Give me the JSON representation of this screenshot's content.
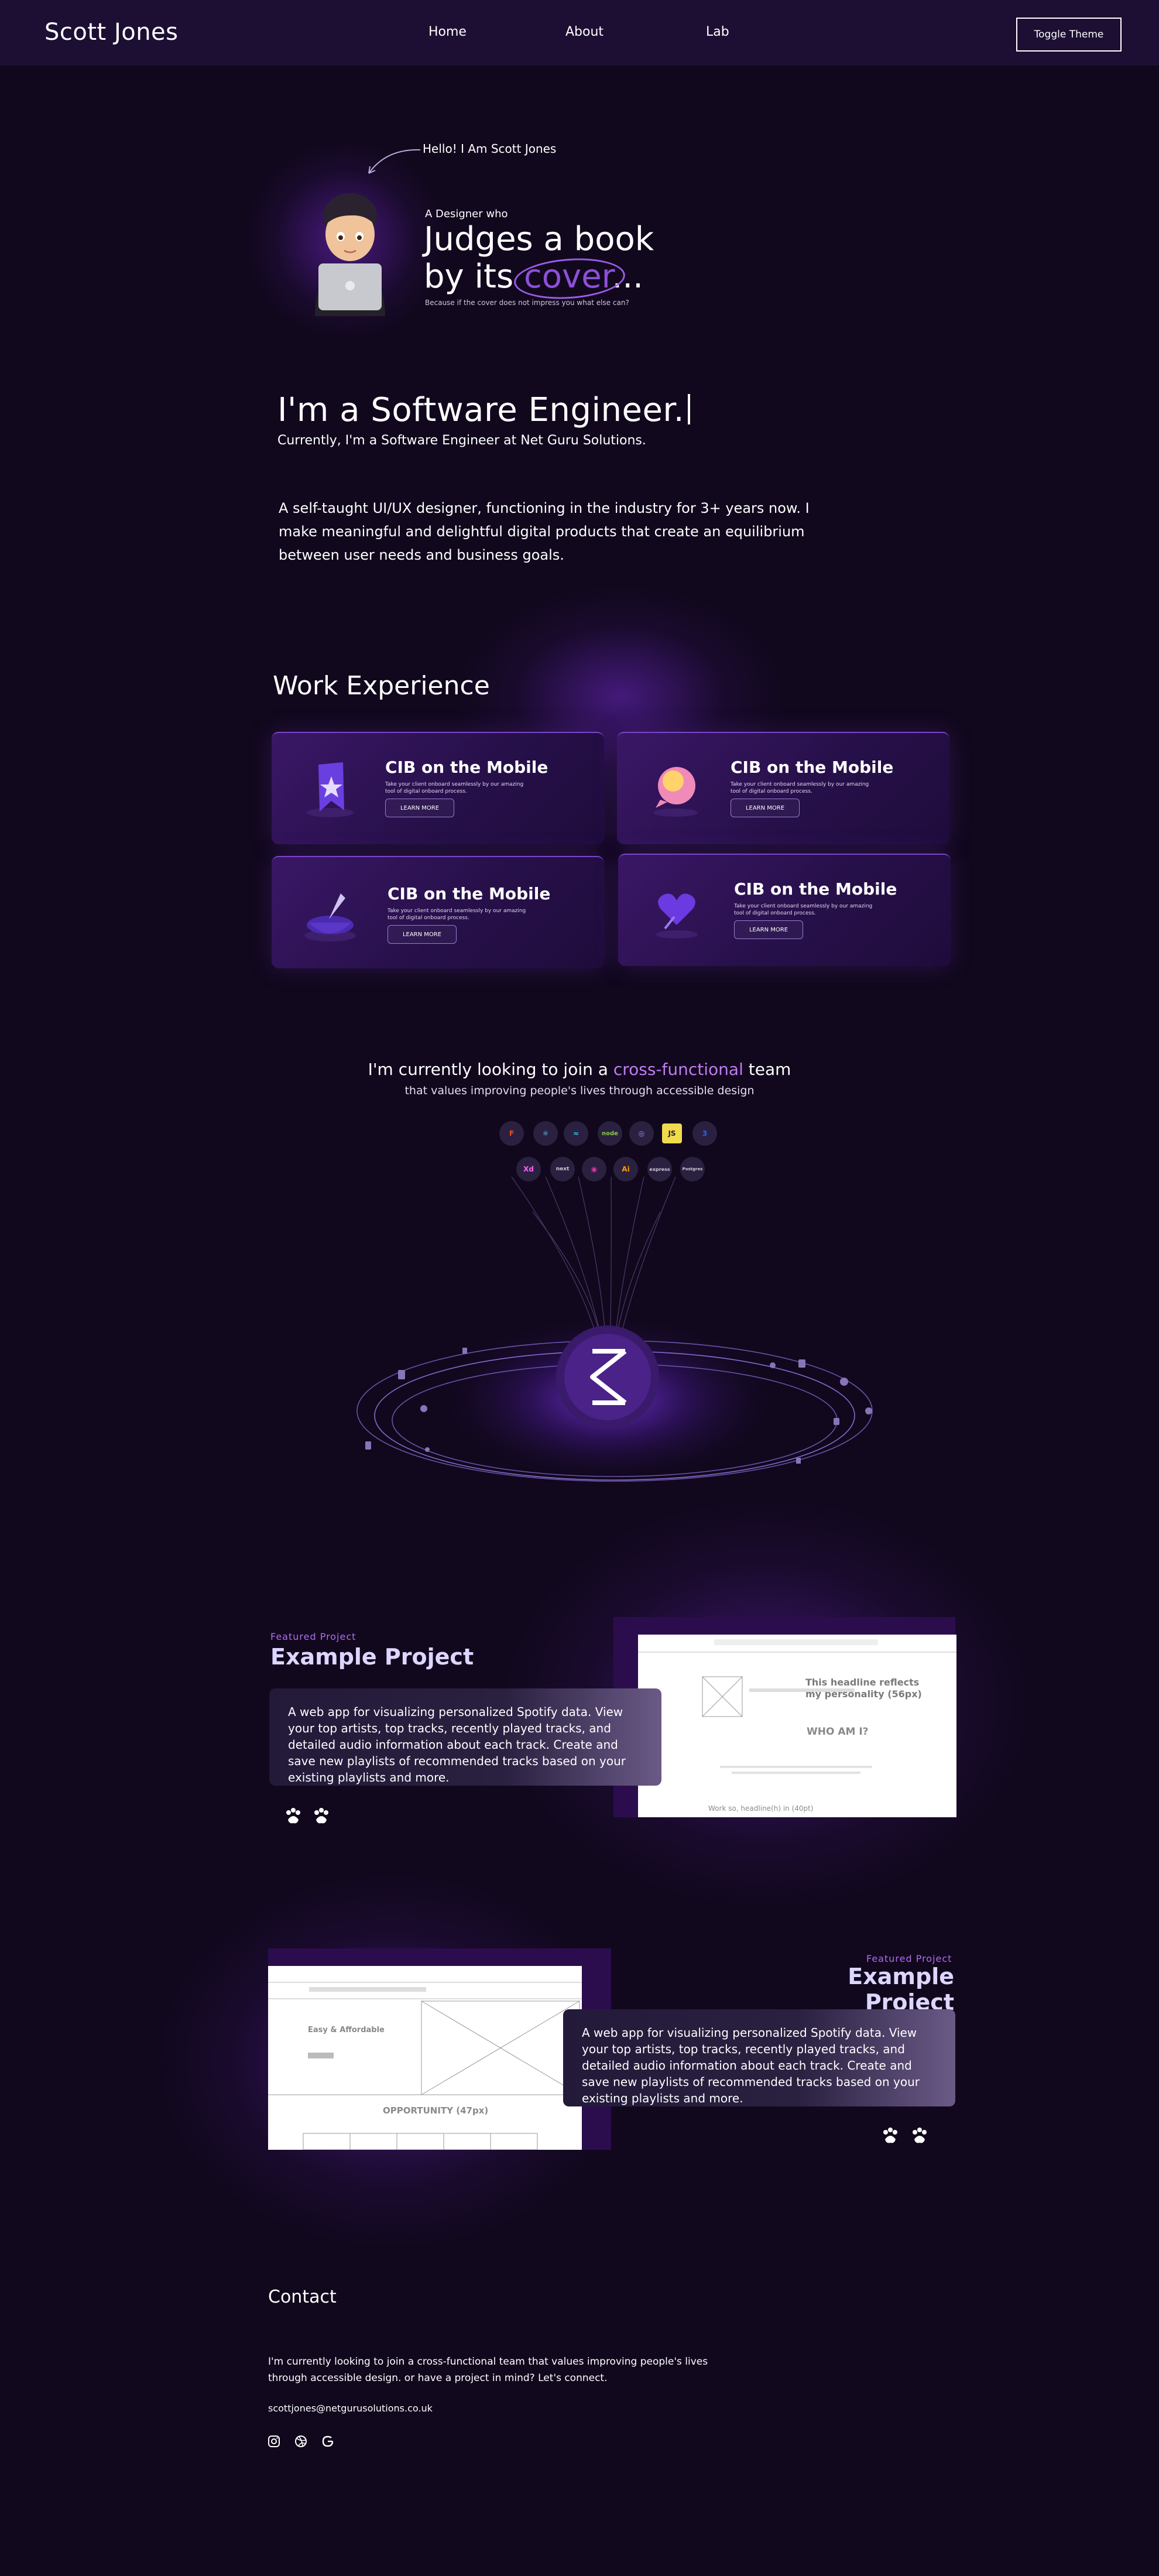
{
  "nav": {
    "brand": "Scott Jones",
    "links": [
      "Home",
      "About",
      "Lab"
    ],
    "toggle_label": "Toggle Theme"
  },
  "hero": {
    "hello": "Hello! I Am Scott Jones",
    "designer_who": "A Designer who",
    "headline_line1": "Judges a book",
    "headline_line2_prefix": "by its",
    "headline_highlight": "cover",
    "headline_suffix": "...",
    "tagline": "Because if the cover does not impress you what else can?"
  },
  "intro": {
    "role": "I'm a Software Engineer.",
    "current": "Currently, I'm a Software Engineer at Net Guru Solutions.",
    "bio": "A self-taught UI/UX designer, functioning in the industry for 3+ years now. I make meaningful and delightful digital products that create an equilibrium between user needs and business goals."
  },
  "work": {
    "title": "Work Experience",
    "cards": [
      {
        "title": "CIB on the Mobile",
        "desc": "Take your client onboard seamlessly by our amazing tool of digital onboard process.",
        "button": "LEARN MORE"
      },
      {
        "title": "CIB on the Mobile",
        "desc": "Take your client onboard seamlessly by our amazing tool of digital onboard process.",
        "button": "LEARN MORE"
      },
      {
        "title": "CIB on the Mobile",
        "desc": "Take your client onboard seamlessly by our amazing tool of digital onboard process.",
        "button": "LEARN MORE"
      },
      {
        "title": "CIB on the Mobile",
        "desc": "Take your client onboard seamlessly by our amazing tool of digital onboard process.",
        "button": "LEARN MORE"
      }
    ]
  },
  "skills": {
    "join_prefix": "I'm currently looking to join a",
    "join_accent": "cross-functional",
    "join_suffix": "team",
    "subtitle": "that values improving people's lives through accessible design",
    "row1": [
      "figma-icon",
      "react-icon",
      "tailwind-icon",
      "node-icon",
      "redux-icon",
      "javascript-icon",
      "css-icon"
    ],
    "row1_labels": [
      "F",
      "⚛",
      "≈",
      "node",
      "◎",
      "JS",
      "3"
    ],
    "row2_labels": [
      "Xd",
      "next",
      "◉",
      "Ai",
      "express",
      "Postgres"
    ],
    "row2": [
      "xd-icon",
      "next-icon",
      "graphql-icon",
      "illustrator-icon",
      "express-icon",
      "postgres-icon"
    ],
    "hub_symbol": "⟨"
  },
  "projects": [
    {
      "label": "Featured Project",
      "title": "Example Project",
      "description": "A web app for visualizing personalized Spotify data. View your top artists, top tracks, recently played tracks, and detailed audio information about each track. Create and save new playlists of recommended tracks based on your existing playlists and more.",
      "mock_headline": "This headline reflects my personality (56px)",
      "mock_who": "WHO AM I?",
      "mock_footer": "Work so, headline(h) in (40pt)"
    },
    {
      "label": "Featured Project",
      "title": "Example Project",
      "description": "A web app for visualizing personalized Spotify data. View your top artists, top tracks, recently played tracks, and detailed audio information about each track. Create and save new playlists of recommended tracks based on your existing playlists and more.",
      "mock_heading": "Easy & Affordable",
      "mock_opportunity": "OPPORTUNITY (47px)"
    }
  ],
  "contact": {
    "title": "Contact",
    "text": "I'm currently looking to join a cross-functional team that values improving people's lives through accessible design. or have a project in mind? Let's connect.",
    "email": "scottjones@netgurusolutions.co.uk"
  },
  "colors": {
    "background": "#11081d",
    "nav": "#1d0f33",
    "accent": "#8e4fd8",
    "accent_light": "#c17cf4"
  }
}
